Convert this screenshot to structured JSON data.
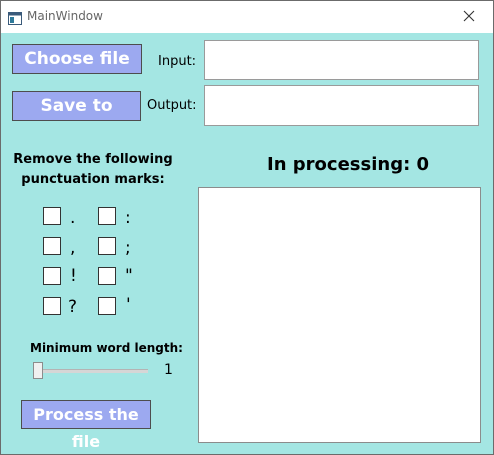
{
  "window": {
    "title": "MainWindow"
  },
  "buttons": {
    "choose_file": "Choose file",
    "save_to": "Save to",
    "process": "Process the file"
  },
  "labels": {
    "input": "Input:",
    "output": "Output:"
  },
  "fields": {
    "input_value": "",
    "output_value": ""
  },
  "punctuation": {
    "heading_line1": "Remove the following",
    "heading_line2": "punctuation marks:",
    "marks": [
      ".",
      ",",
      "!",
      "?",
      ":",
      ";",
      "\"",
      "'"
    ],
    "checked": [
      false,
      false,
      false,
      false,
      false,
      false,
      false,
      false
    ]
  },
  "min_word_length": {
    "label": "Minimum word length:",
    "value": "1"
  },
  "processing": {
    "label": "In processing: 0"
  },
  "results": {
    "text": ""
  },
  "colors": {
    "background": "#a4e6e3",
    "button": "#9ca9f0"
  },
  "icons": {
    "app": "window-app-icon",
    "close": "close-icon"
  }
}
